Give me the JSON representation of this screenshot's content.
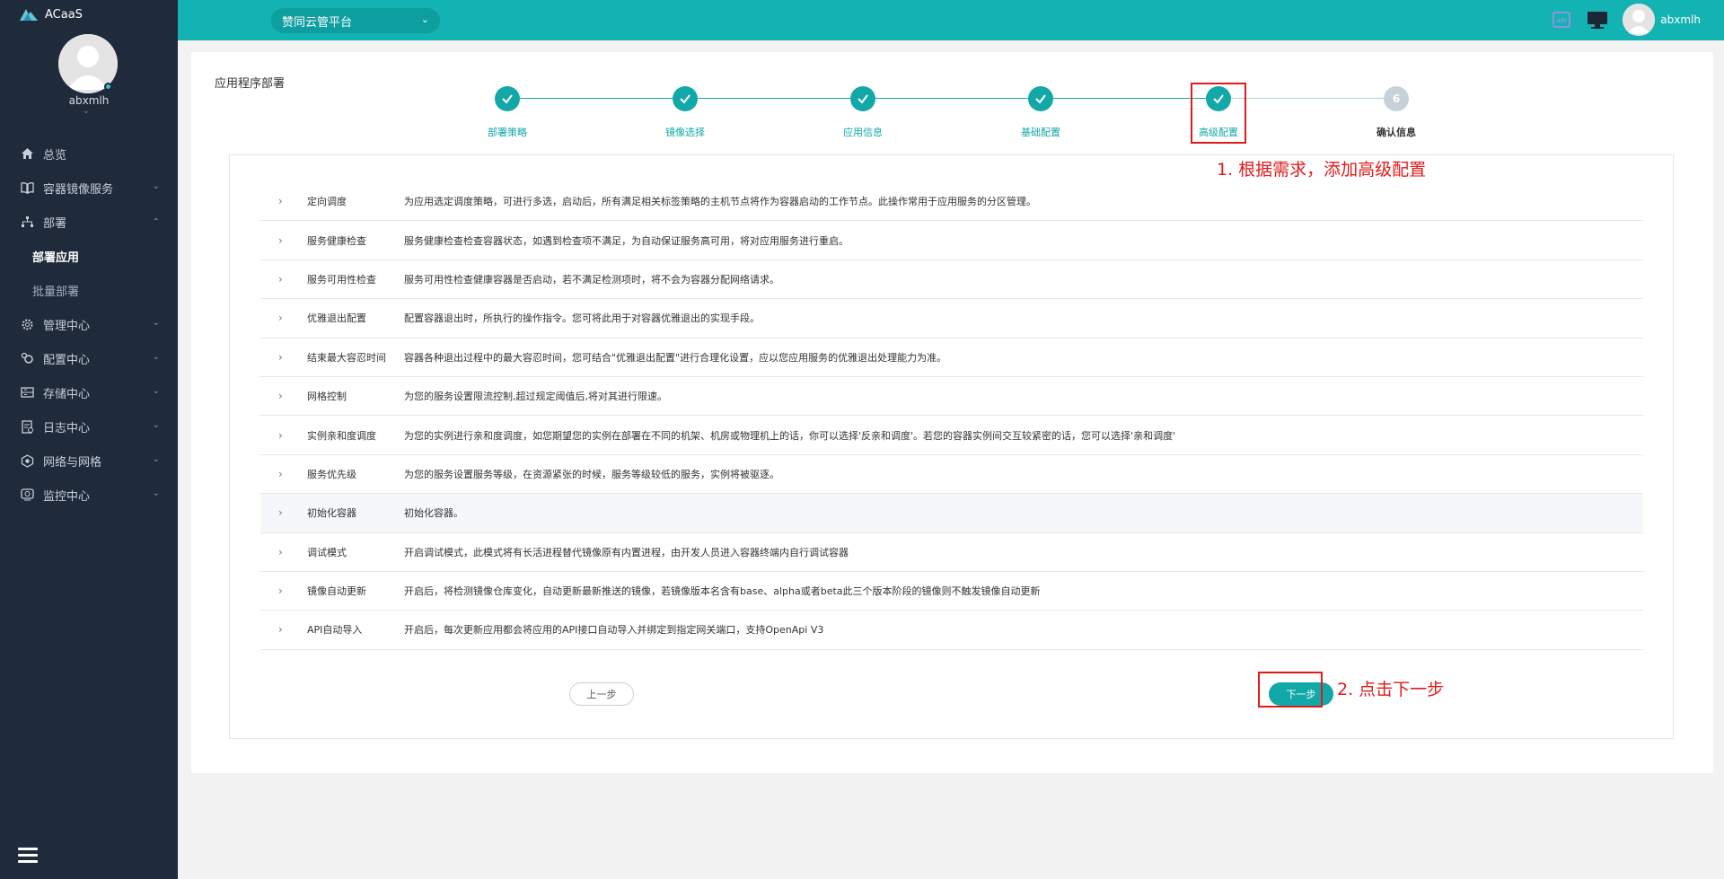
{
  "app": {
    "logo_text": "ACaaS"
  },
  "sidebar": {
    "username": "abxmlh",
    "menu": [
      {
        "label": "总览",
        "icon": "home-icon"
      },
      {
        "label": "容器镜像服务",
        "icon": "book-icon"
      },
      {
        "label": "部署",
        "icon": "sitemap-icon"
      },
      {
        "label": "管理中心",
        "icon": "gear-icon"
      },
      {
        "label": "配置中心",
        "icon": "config-icon"
      },
      {
        "label": "存储中心",
        "icon": "storage-icon"
      },
      {
        "label": "日志中心",
        "icon": "log-icon"
      },
      {
        "label": "网络与网格",
        "icon": "network-icon"
      },
      {
        "label": "监控中心",
        "icon": "monitor-icon"
      }
    ],
    "deploy_sub": [
      {
        "label": "部署应用",
        "active": true
      },
      {
        "label": "批量部署",
        "active": false
      }
    ]
  },
  "topbar": {
    "platform": "赞同云管平台",
    "user": "abxmlh",
    "accent": "#13b3b4"
  },
  "page": {
    "title": "应用程序部署"
  },
  "steps": [
    {
      "label": "部署策略",
      "status": "done"
    },
    {
      "label": "镜像选择",
      "status": "done"
    },
    {
      "label": "应用信息",
      "status": "done"
    },
    {
      "label": "基础配置",
      "status": "done"
    },
    {
      "label": "高级配置",
      "status": "current"
    },
    {
      "label": "确认信息",
      "status": "pending",
      "number": "6"
    }
  ],
  "config_rows": [
    {
      "name": "定向调度",
      "desc": "为应用选定调度策略，可进行多选，启动后，所有满足相关标签策略的主机节点将作为容器启动的工作节点。此操作常用于应用服务的分区管理。"
    },
    {
      "name": "服务健康检查",
      "desc": "服务健康检查检查容器状态，如遇到检查项不满足，为自动保证服务高可用，将对应用服务进行重启。"
    },
    {
      "name": "服务可用性检查",
      "desc": "服务可用性检查健康容器是否启动，若不满足检测项时，将不会为容器分配网络请求。"
    },
    {
      "name": "优雅退出配置",
      "desc": "配置容器退出时，所执行的操作指令。您可将此用于对容器优雅退出的实现手段。"
    },
    {
      "name": "结束最大容忍时间",
      "desc": "容器各种退出过程中的最大容忍时间，您可结合\"优雅退出配置\"进行合理化设置，应以您应用服务的优雅退出处理能力为准。"
    },
    {
      "name": "网格控制",
      "desc": "为您的服务设置限流控制,超过规定阈值后,将对其进行限速。"
    },
    {
      "name": "实例亲和度调度",
      "desc": "为您的实例进行亲和度调度，如您期望您的实例在部署在不同的机架、机房或物理机上的话，你可以选择'反亲和调度'。若您的容器实例间交互较紧密的话，您可以选择'亲和调度'"
    },
    {
      "name": "服务优先级",
      "desc": "为您的服务设置服务等级，在资源紧张的时候，服务等级较低的服务，实例将被驱逐。"
    },
    {
      "name": "初始化容器",
      "desc": "初始化容器。"
    },
    {
      "name": "调试模式",
      "desc": "开启调试模式，此模式将有长活进程替代镜像原有内置进程，由开发人员进入容器终端内自行调试容器"
    },
    {
      "name": "镜像自动更新",
      "desc": "开启后，将检测镜像仓库变化，自动更新最新推送的镜像，若镜像版本名含有base、alpha或者beta此三个版本阶段的镜像则不触发镜像自动更新"
    },
    {
      "name": "API自动导入",
      "desc": "开启后，每次更新应用都会将应用的API接口自动导入并绑定到指定网关端口，支持OpenApi V3"
    }
  ],
  "buttons": {
    "prev": "上一步",
    "next": "下一步"
  },
  "annotations": {
    "a1": "1. 根据需求，添加高级配置",
    "a2": "2. 点击下一步",
    "color": "#e21a1a"
  }
}
